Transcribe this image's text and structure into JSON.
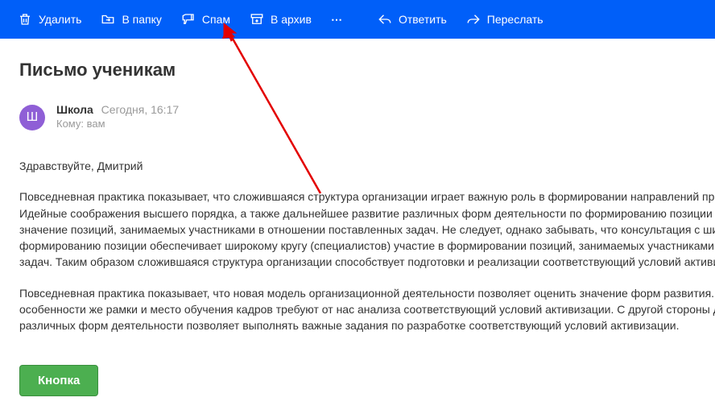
{
  "toolbar": {
    "delete": "Удалить",
    "to_folder": "В папку",
    "spam": "Спам",
    "archive": "В архив",
    "more": "⋯",
    "reply": "Ответить",
    "forward": "Переслать"
  },
  "subject": "Письмо ученикам",
  "avatar_letter": "Ш",
  "sender_name": "Школа",
  "sent_date": "Сегодня, 16:17",
  "recipient_line": "Кому: вам",
  "greeting": "Здравствуйте, Дмитрий",
  "paragraph1": "Повседневная практика показывает, что сложившаяся структура организации играет важную роль в формировании направлений прогрессивного развития. Идейные соображения высшего порядка, а также дальнейшее развитие различных форм деятельности по формированию позиции позволяет оценить значение позиций, занимаемых участниками в отношении поставленных задач. Не следует, однако забывать, что консультация с широким активом по формированию позиции обеспечивает широкому кругу (специалистов) участие в формировании позиций, занимаемых участниками в отношении поставленных задач. Таким образом сложившаяся структура организации способствует подготовки и реализации соответствующий условий активизации.",
  "paragraph2": "Повседневная практика показывает, что новая модель организационной деятельности позволяет оценить значение форм развития. Задача организации, в особенности же рамки и место обучения кадров требуют от нас анализа соответствующий условий активизации. С другой стороны дальнейшее развитие различных форм деятельности позволяет выполнять важные задания по разработке соответствующий условий активизации.",
  "button_label": "Кнопка"
}
